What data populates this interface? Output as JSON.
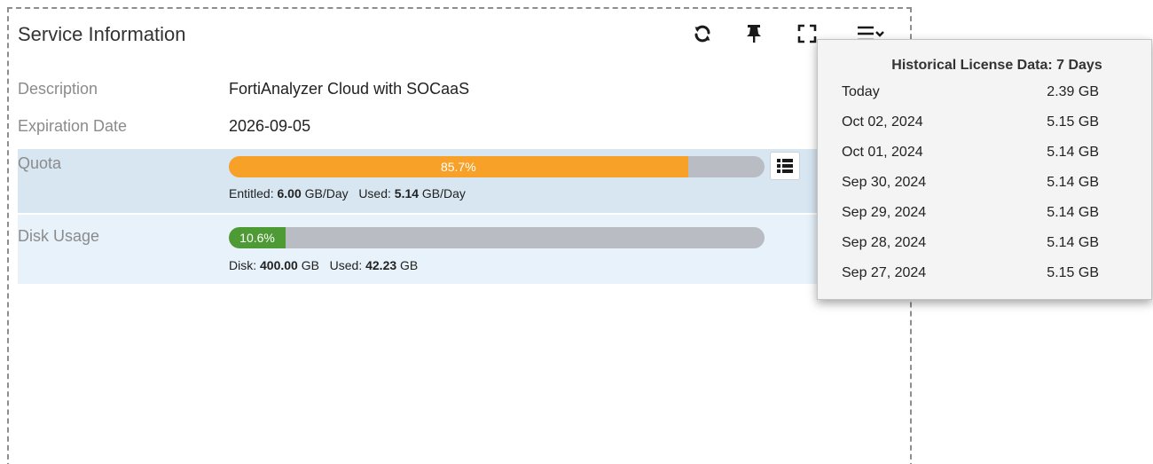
{
  "widget": {
    "title": "Service Information",
    "toolbar": {
      "icons": [
        "refresh-icon",
        "pin-icon",
        "fullscreen-icon",
        "menu-icon"
      ]
    }
  },
  "rows": {
    "description": {
      "label": "Description",
      "value": "FortiAnalyzer Cloud with SOCaaS"
    },
    "expiration": {
      "label": "Expiration Date",
      "value": "2026-09-05"
    },
    "quota": {
      "label": "Quota",
      "percent": 85.7,
      "percent_text": "85.7%",
      "entitled_label": "Entitled:",
      "entitled_value": "6.00",
      "entitled_unit": "GB/Day",
      "used_label": "Used:",
      "used_value": "5.14",
      "used_unit": "GB/Day"
    },
    "disk": {
      "label": "Disk Usage",
      "percent": 10.6,
      "percent_text": "10.6%",
      "disk_label": "Disk:",
      "disk_value": "400.00",
      "disk_unit": "GB",
      "used_label": "Used:",
      "used_value": "42.23",
      "used_unit": "GB"
    }
  },
  "history_popup": {
    "title": "Historical License Data: 7 Days",
    "entries": [
      {
        "date": "Today",
        "size": "2.39 GB"
      },
      {
        "date": "Oct 02, 2024",
        "size": "5.15 GB"
      },
      {
        "date": "Oct 01, 2024",
        "size": "5.14 GB"
      },
      {
        "date": "Sep 30, 2024",
        "size": "5.14 GB"
      },
      {
        "date": "Sep 29, 2024",
        "size": "5.14 GB"
      },
      {
        "date": "Sep 28, 2024",
        "size": "5.14 GB"
      },
      {
        "date": "Sep 27, 2024",
        "size": "5.15 GB"
      }
    ]
  },
  "colors": {
    "quota_bar": "#f7a128",
    "disk_bar": "#4e9a34",
    "bar_track": "#b9bcc2",
    "row_shade_quota": "#d7e6f1",
    "row_shade_disk": "#e7f2fa"
  }
}
